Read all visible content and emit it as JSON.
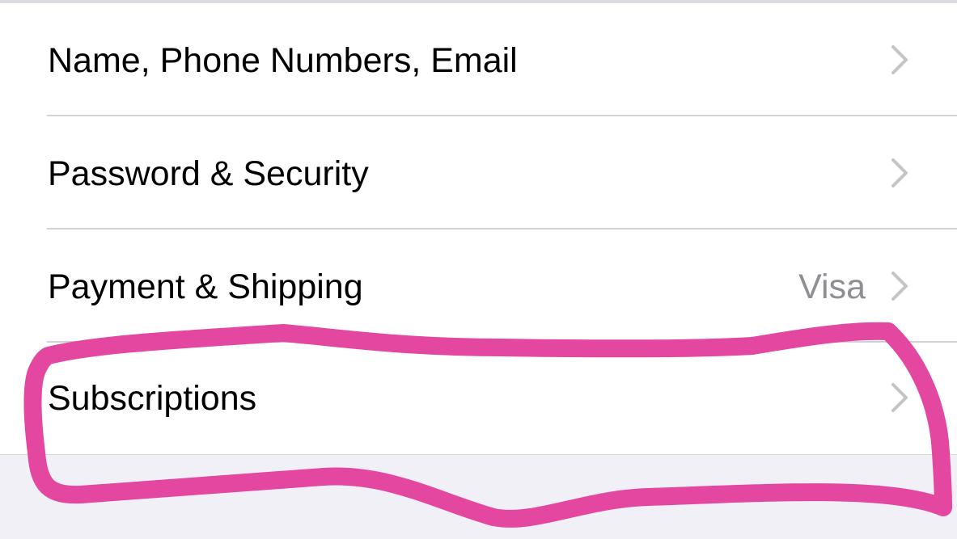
{
  "settings": {
    "items": [
      {
        "label": "Name, Phone Numbers, Email",
        "value": "",
        "icon": "chevron-right-icon"
      },
      {
        "label": "Password & Security",
        "value": "",
        "icon": "chevron-right-icon"
      },
      {
        "label": "Payment & Shipping",
        "value": "Visa",
        "icon": "chevron-right-icon"
      },
      {
        "label": "Subscriptions",
        "value": "",
        "icon": "chevron-right-icon"
      }
    ]
  },
  "colors": {
    "background": "#ffffff",
    "grouped_background": "#f1f0f6",
    "separator": "#d1d1d6",
    "secondary_text": "#8e8e93",
    "chevron": "#c4c4c7",
    "annotation": "#e4479f"
  },
  "annotation": {
    "type": "hand-drawn-outline",
    "target": "Subscriptions row"
  }
}
